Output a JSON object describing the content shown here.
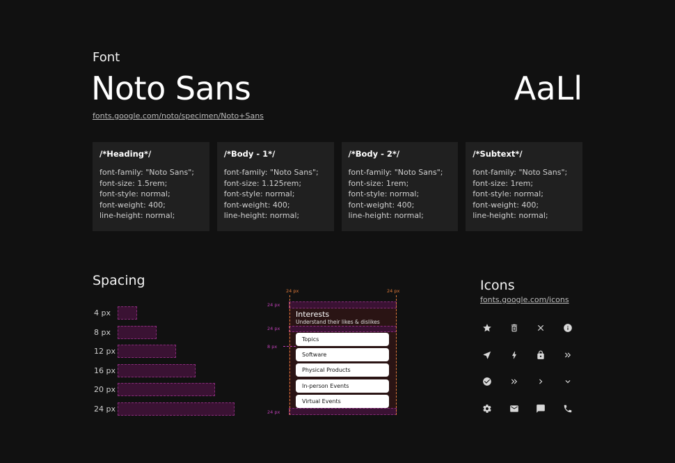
{
  "font": {
    "label": "Font",
    "name": "Noto Sans",
    "sample": "AaLl",
    "link": "fonts.google.com/noto/specimen/Noto+Sans"
  },
  "specs": [
    {
      "title": "/*Heading*/",
      "lines": [
        "font-family: \"Noto Sans\";",
        "font-size: 1.5rem;",
        "font-style: normal;",
        "font-weight: 400;",
        "line-height: normal;"
      ]
    },
    {
      "title": "/*Body - 1*/",
      "lines": [
        "font-family: \"Noto Sans\";",
        "font-size: 1.125rem;",
        "font-style: normal;",
        "font-weight: 400;",
        "line-height: normal;"
      ]
    },
    {
      "title": "/*Body - 2*/",
      "lines": [
        "font-family: \"Noto Sans\";",
        "font-size: 1rem;",
        "font-style: normal;",
        "font-weight: 400;",
        "line-height: normal;"
      ]
    },
    {
      "title": "/*Subtext*/",
      "lines": [
        "font-family: \"Noto Sans\";",
        "font-size: 1rem;",
        "font-style: normal;",
        "font-weight: 400;",
        "line-height: normal;"
      ]
    }
  ],
  "spacing": {
    "title": "Spacing",
    "scale": [
      {
        "label": "4 px",
        "value": 4
      },
      {
        "label": "8 px",
        "value": 8
      },
      {
        "label": "12 px",
        "value": 12
      },
      {
        "label": "16 px",
        "value": 16
      },
      {
        "label": "20 px",
        "value": 20
      },
      {
        "label": "24 px",
        "value": 24
      }
    ],
    "demo": {
      "title": "Interests",
      "subtitle": "Understand their likes & dislikes",
      "items": [
        "Topics",
        "Software",
        "Physical Products",
        "In-person Events",
        "Virtual Events"
      ],
      "measure_labels": {
        "top_left": "24 px",
        "top_right": "24 px",
        "side_top": "24 px",
        "side_mid": "24 px",
        "side_gap": "8 px",
        "side_bottom": "24 px"
      }
    }
  },
  "icons": {
    "title": "Icons",
    "link": "fonts.google.com/icons",
    "names": [
      "star-icon",
      "delete-icon",
      "close-icon",
      "info-icon",
      "navigation-icon",
      "bolt-icon",
      "lock-icon",
      "double-chevron-right-icon",
      "check-circle-icon",
      "double-chevron-right-icon",
      "chevron-right-icon",
      "chevron-down-icon",
      "settings-icon",
      "mail-icon",
      "chat-icon",
      "phone-icon"
    ],
    "color": "#d8d8d8"
  },
  "colors": {
    "background": "#111111",
    "card": "#202020",
    "spacing_fill": "#3a1233",
    "spacing_border": "#8a2c7c",
    "measure_magenta": "#c040b8",
    "measure_orange": "#e07a3a"
  }
}
